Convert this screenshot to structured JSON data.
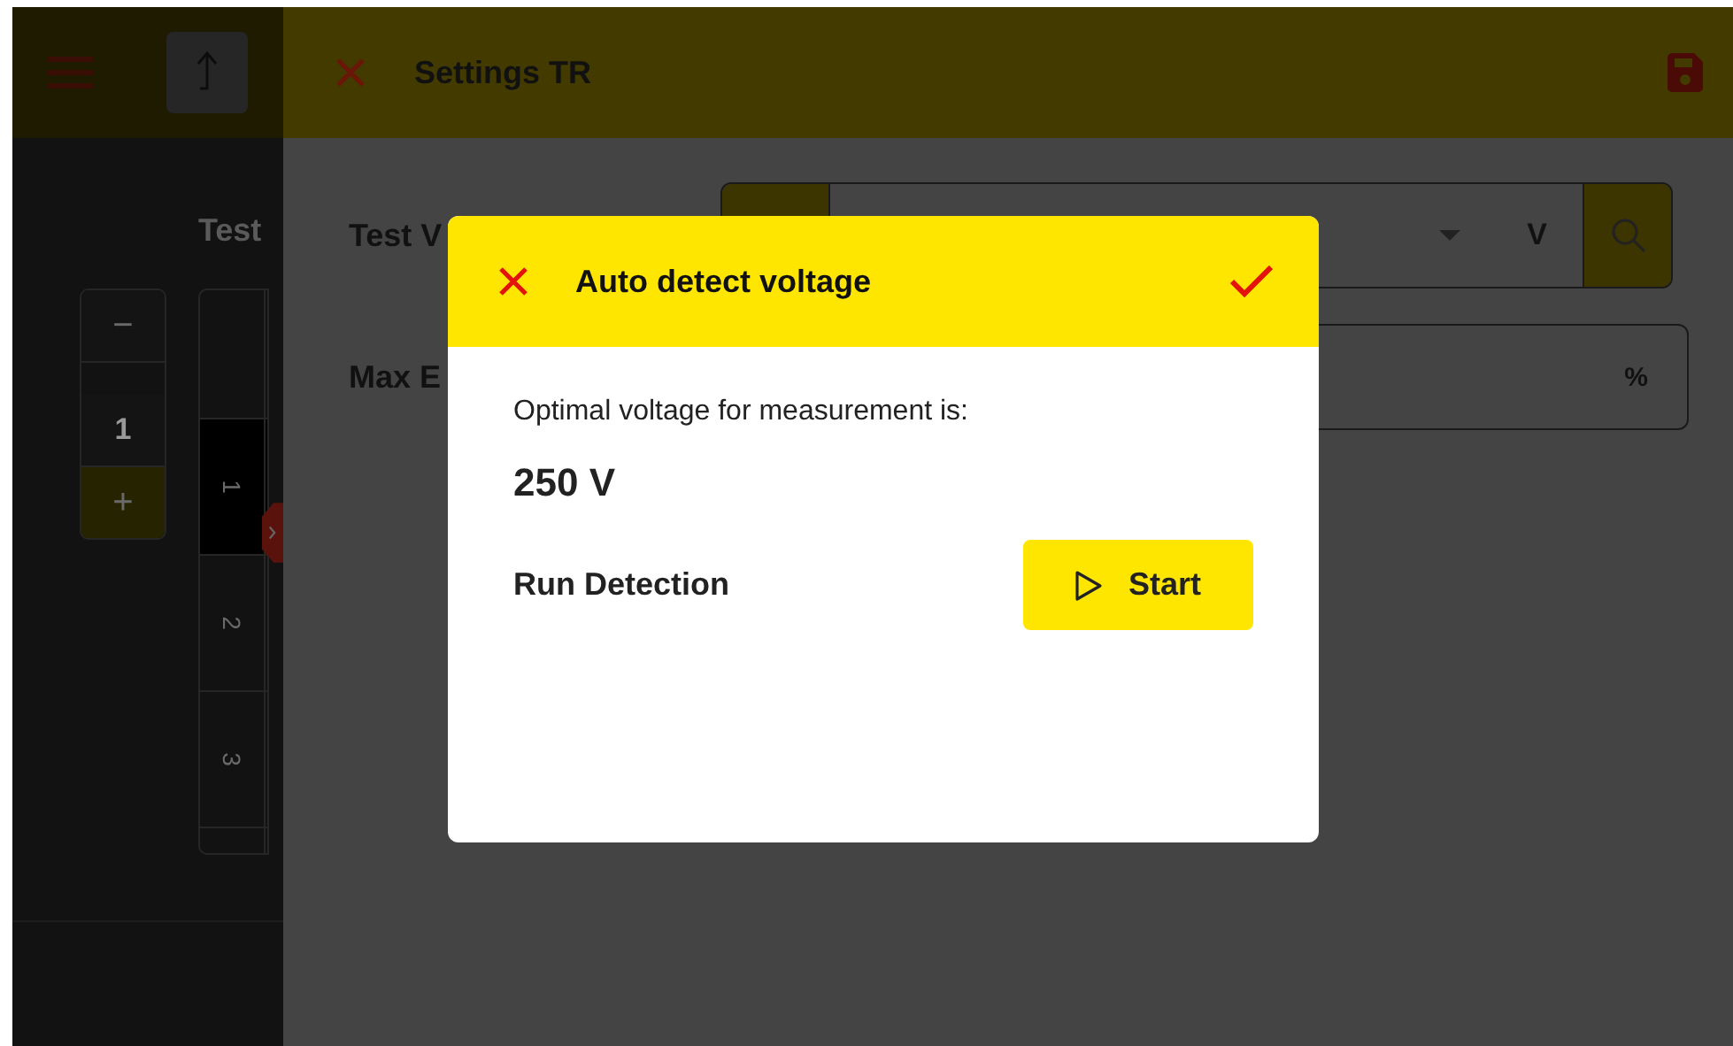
{
  "back_panel": {
    "label": "Test",
    "stepper": {
      "minus": "−",
      "value": "1",
      "plus": "+"
    },
    "rows": [
      {
        "label": "1",
        "selected": true
      },
      {
        "label": "2",
        "selected": false
      },
      {
        "label": "3",
        "selected": false
      }
    ]
  },
  "settings": {
    "title": "Settings TR",
    "fields": [
      {
        "label": "Test V",
        "unit": "V",
        "kind": "select"
      },
      {
        "label": "Max E",
        "unit": "%",
        "kind": "input"
      }
    ]
  },
  "dialog": {
    "title": "Auto detect voltage",
    "message": "Optimal voltage for measurement is:",
    "value": "250 V",
    "action_label": "Run Detection",
    "button": "Start"
  }
}
